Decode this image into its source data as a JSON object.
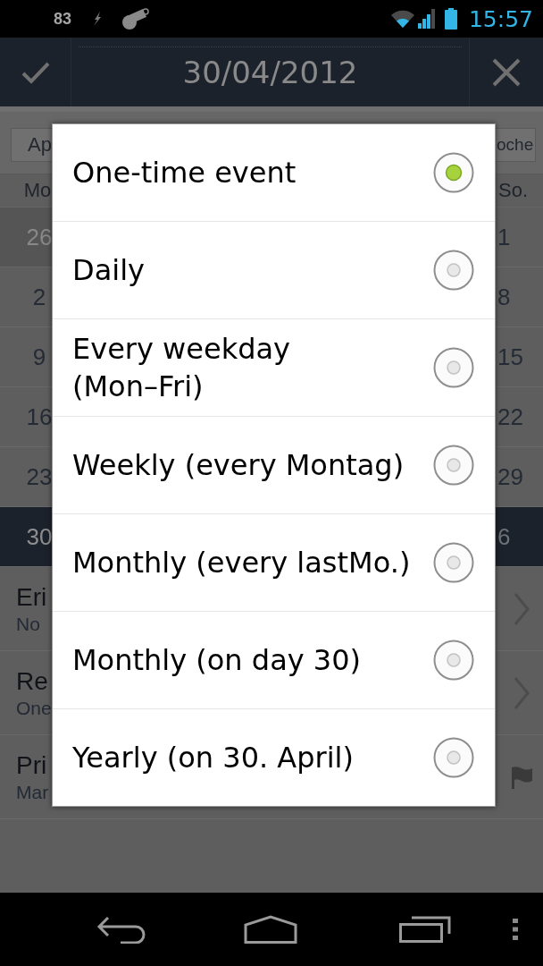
{
  "status_bar": {
    "indicator": "83",
    "time": "15:57"
  },
  "header": {
    "title": "30/04/2012"
  },
  "calendar": {
    "toolbar": [
      {
        "label": "Ap"
      },
      {
        "label": "oche"
      }
    ],
    "weekdays": [
      "Mo",
      "So."
    ],
    "weeks": [
      {
        "selected": false,
        "days": [
          {
            "label": "26",
            "outside_month": true
          },
          {
            "label": "1",
            "outside_month": false
          }
        ]
      },
      {
        "selected": false,
        "days": [
          {
            "label": "2",
            "outside_month": false
          },
          {
            "label": "8",
            "outside_month": false
          }
        ]
      },
      {
        "selected": false,
        "days": [
          {
            "label": "9",
            "outside_month": false
          },
          {
            "label": "15",
            "outside_month": false
          }
        ]
      },
      {
        "selected": false,
        "days": [
          {
            "label": "16",
            "outside_month": false
          },
          {
            "label": "22",
            "outside_month": false
          }
        ]
      },
      {
        "selected": false,
        "days": [
          {
            "label": "23",
            "outside_month": false
          },
          {
            "label": "29",
            "outside_month": false
          }
        ]
      },
      {
        "selected": true,
        "days": [
          {
            "label": "30",
            "outside_month": false
          },
          {
            "label": "6",
            "outside_month": true
          }
        ]
      }
    ]
  },
  "entries": [
    {
      "kind": "chevron",
      "title": "Eri",
      "subtitle": "No"
    },
    {
      "kind": "chevron",
      "title": "Re",
      "subtitle": "One"
    },
    {
      "kind": "flag",
      "title": "Pri",
      "subtitle": "Mar"
    }
  ],
  "dialog": {
    "options": [
      {
        "label": "One-time event",
        "selected": true
      },
      {
        "label": "Daily",
        "selected": false
      },
      {
        "label": "Every weekday (Mon–Fri)",
        "selected": false
      },
      {
        "label": "Weekly (every Montag)",
        "selected": false
      },
      {
        "label": "Monthly (every lastMo.)",
        "selected": false
      },
      {
        "label": "Monthly (on day 30)",
        "selected": false
      },
      {
        "label": "Yearly (on 30. April)",
        "selected": false
      }
    ]
  }
}
